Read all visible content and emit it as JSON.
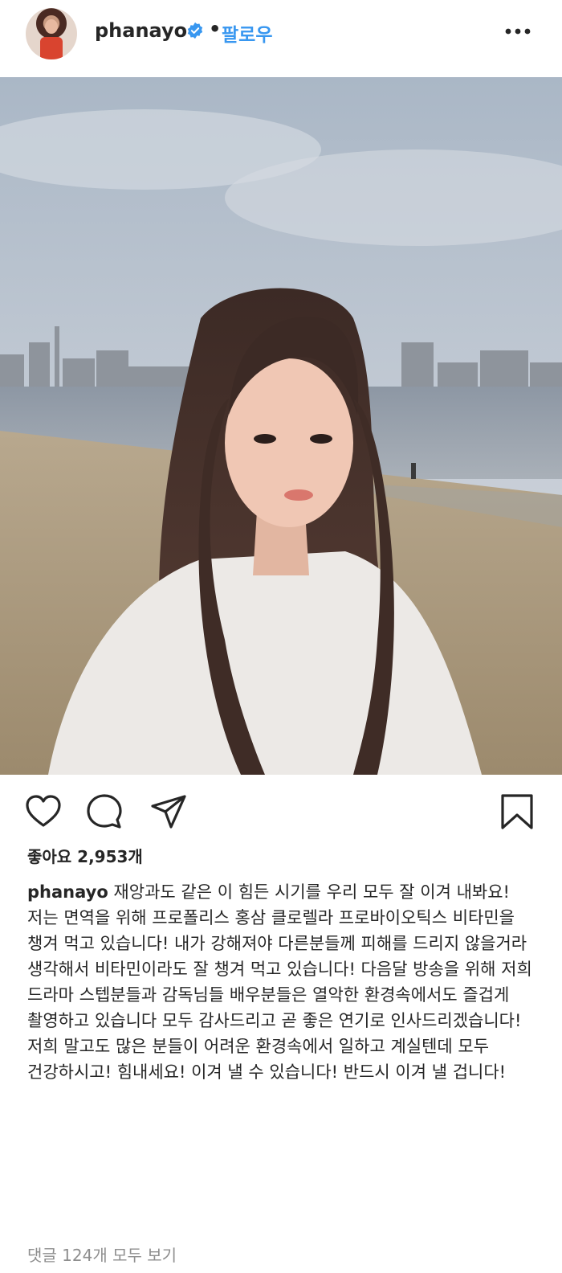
{
  "header": {
    "username": "phanayo",
    "separator": "•",
    "follow_label": "팔로우",
    "verified_icon": "verified-badge-icon",
    "more_icon": "more-options-icon"
  },
  "colors": {
    "follow_blue": "#3897f0",
    "verified_blue": "#3897f0",
    "text": "#262626",
    "muted": "#8e8e8e"
  },
  "actions": {
    "like_icon": "heart-icon",
    "comment_icon": "comment-icon",
    "share_icon": "send-icon",
    "save_icon": "bookmark-icon"
  },
  "likes": {
    "text": "좋아요 2,953개"
  },
  "caption": {
    "username": "phanayo",
    "text": " 재앙과도 같은 이 힘든 시기를 우리 모두 잘 이겨 내봐요!\n저는 면역을 위해 프로폴리스 홍삼 클로렐라 프로바이오틱스 비타민을 챙겨 먹고 있습니다! 내가 강해져야 다른분들께 피해를 드리지 않을거라 생각해서 비타민이라도 잘 챙겨 먹고 있습니다! 다음달 방송을 위해 저희 드라마 스텝분들과 감독님들 배우분들은 열악한 환경속에서도 즐겁게 촬영하고 있습니다 모두 감사드리고 곧 좋은 연기로 인사드리겠습니다!\n저희 말고도 많은 분들이 어려운 환경속에서 일하고 계실텐데 모두 건강하시고! 힘내세요! 이겨 낼 수 있습니다! 반드시 이겨 낼 겁니다!"
  },
  "comments": {
    "view_all": "댓글 124개 모두 보기"
  }
}
